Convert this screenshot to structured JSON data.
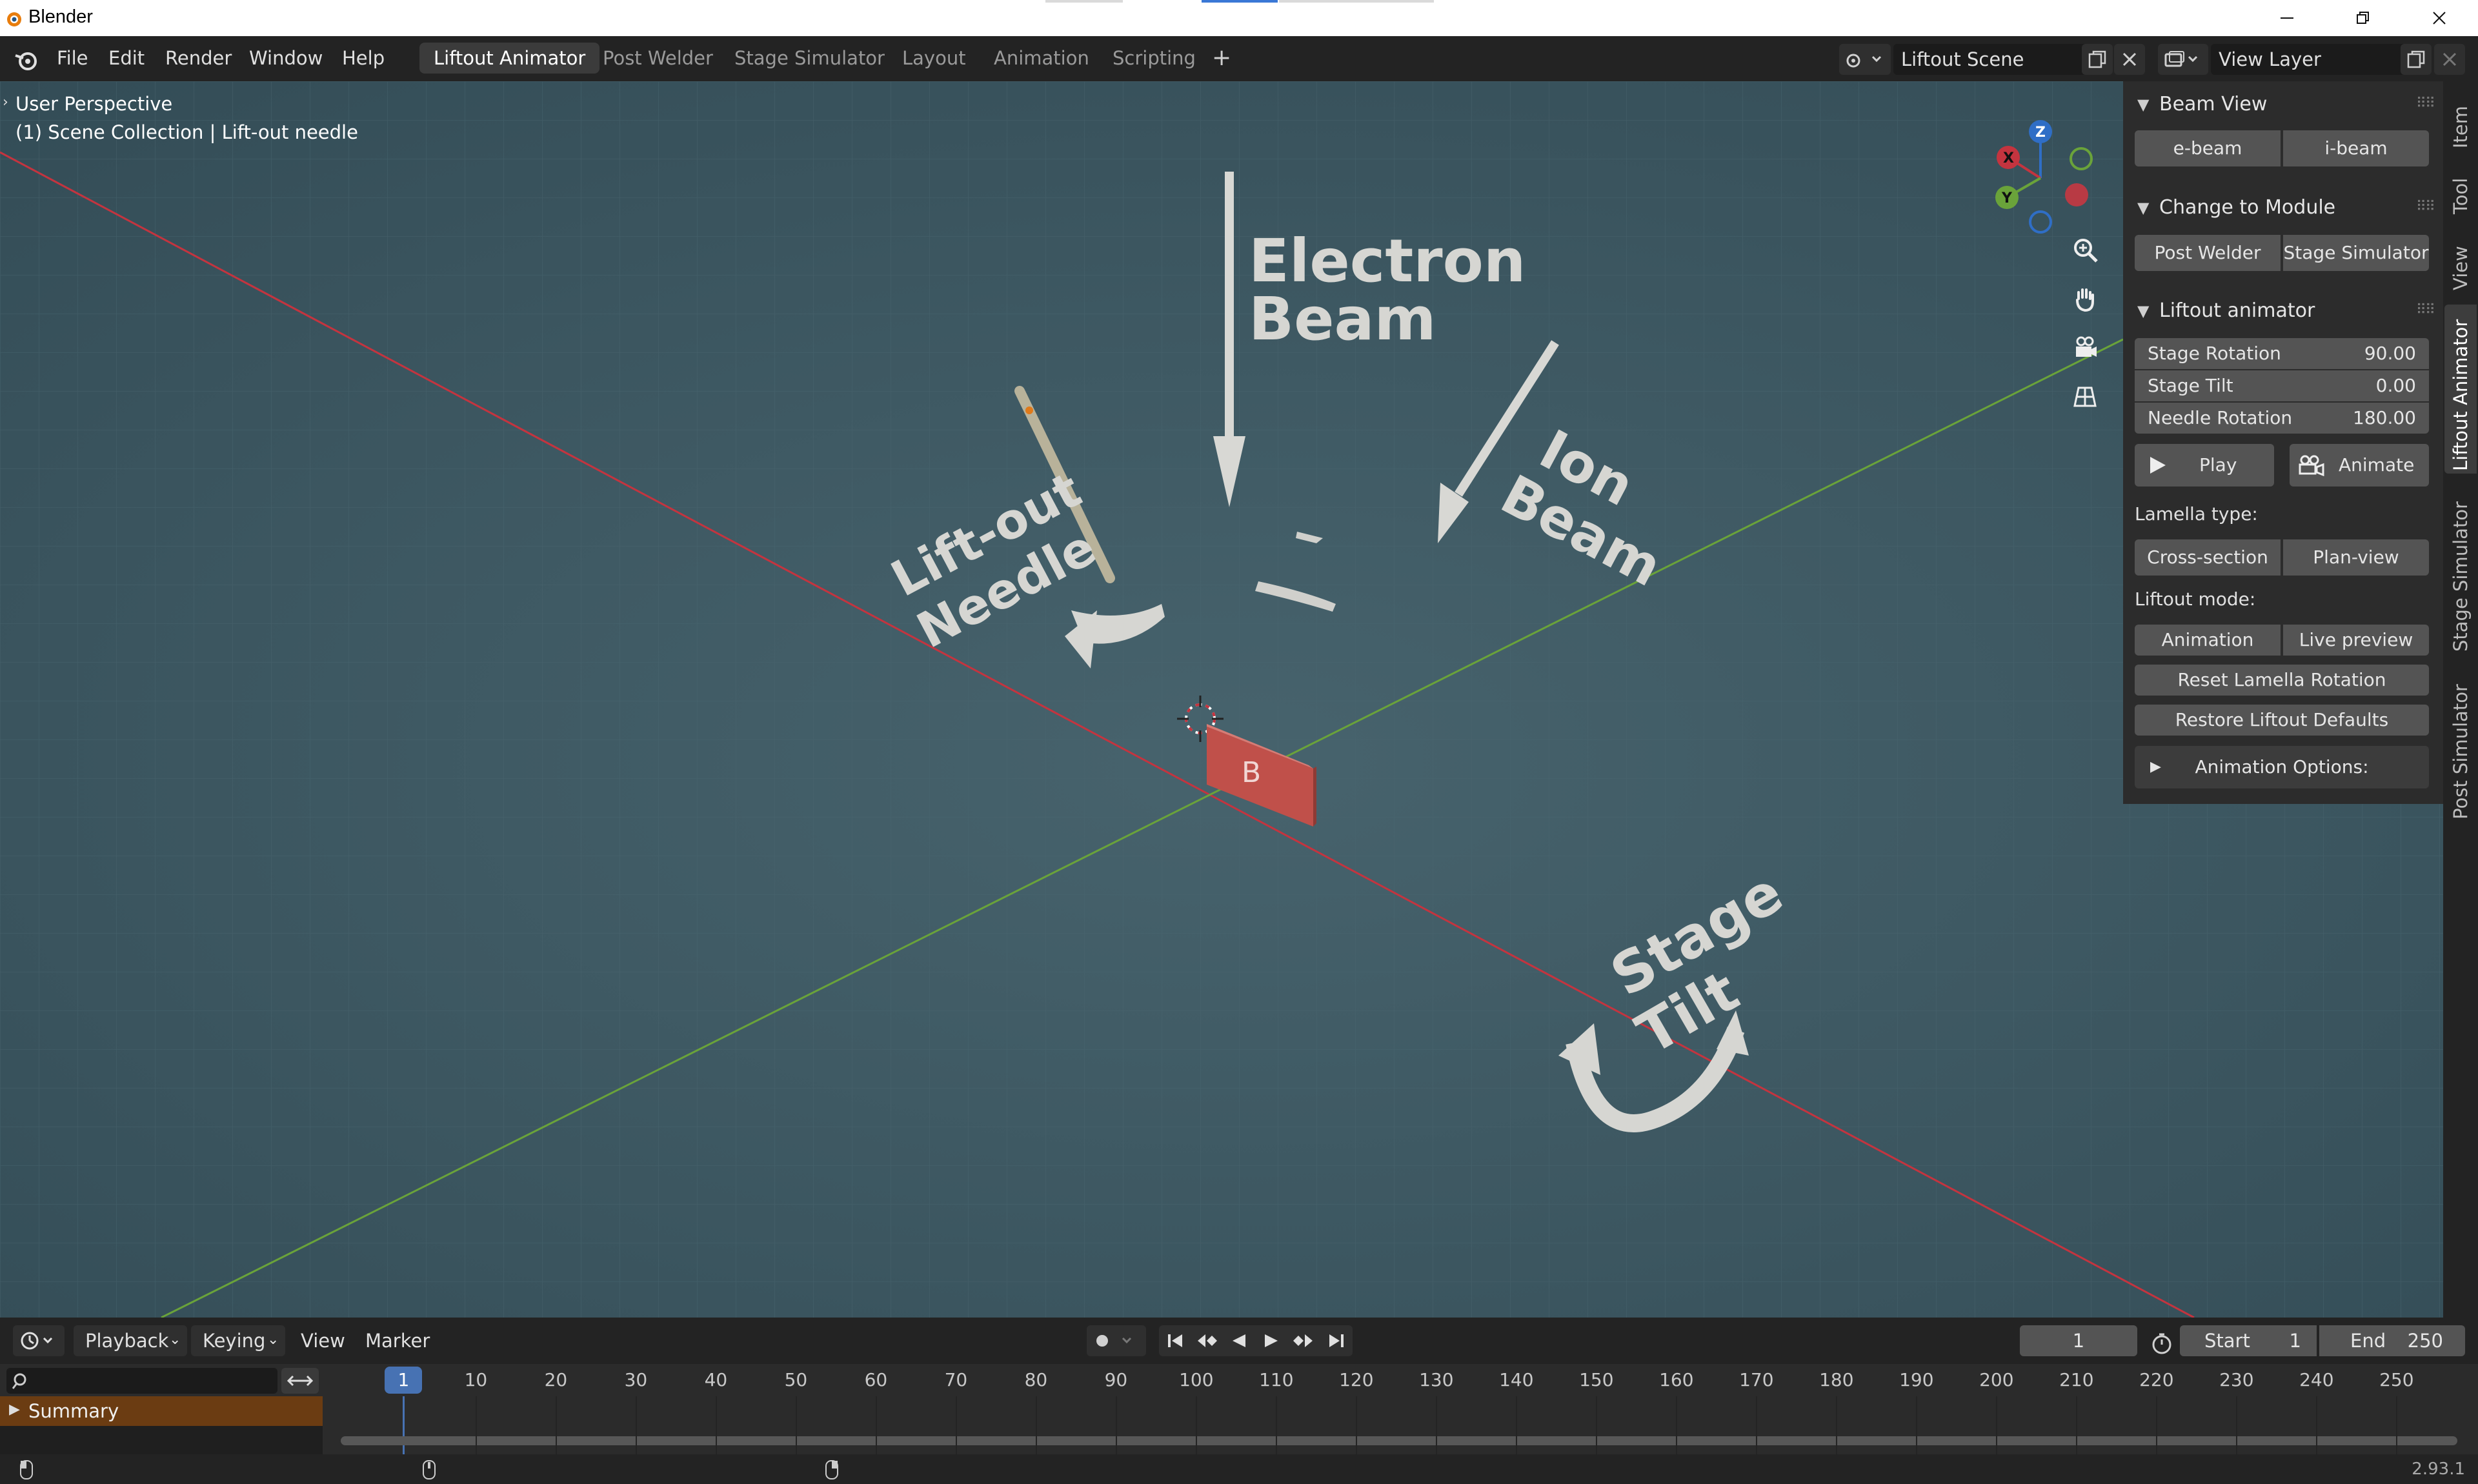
{
  "window": {
    "title": "Blender",
    "controls": [
      "minimize",
      "restore",
      "close"
    ]
  },
  "menu": [
    "File",
    "Edit",
    "Render",
    "Window",
    "Help"
  ],
  "workspaces": [
    {
      "label": "Liftout Animator",
      "active": true
    },
    {
      "label": "Post Welder",
      "active": false
    },
    {
      "label": "Stage Simulator",
      "active": false
    },
    {
      "label": "Layout",
      "active": false
    },
    {
      "label": "Animation",
      "active": false
    },
    {
      "label": "Scripting",
      "active": false
    }
  ],
  "add_workspace": "+",
  "scene": {
    "name": "Liftout Scene",
    "view_layer": "View Layer"
  },
  "viewport": {
    "perspective": "User Perspective",
    "collection": "(1) Scene Collection | Lift-out needle",
    "gizmo": {
      "x": "X",
      "y": "Y",
      "z": "Z"
    },
    "labels": {
      "electron_beam_1": "Electron",
      "electron_beam_2": "Beam",
      "ion_beam_1": "Ion",
      "ion_beam_2": "Beam",
      "needle_1": "Lift-out",
      "needle_2": "Needle",
      "stage_tilt_1": "Stage",
      "stage_tilt_2": "Tilt",
      "sample": "B"
    }
  },
  "npanel": {
    "tabs": [
      "Item",
      "Tool",
      "View",
      "Liftout Animator",
      "Stage Simulator",
      "Post Simulator"
    ],
    "active_tab": "Liftout Animator",
    "beam_view": {
      "title": "Beam View",
      "buttons": [
        "e-beam",
        "i-beam"
      ]
    },
    "change_module": {
      "title": "Change to Module",
      "buttons": [
        "Post Welder",
        "Stage Simulator"
      ]
    },
    "liftout": {
      "title": "Liftout animator",
      "fields": [
        {
          "label": "Stage Rotation",
          "value": "90.00"
        },
        {
          "label": "Stage Tilt",
          "value": "0.00"
        },
        {
          "label": "Needle Rotation",
          "value": "180.00"
        }
      ],
      "play": "Play",
      "animate": "Animate",
      "lamella_label": "Lamella type:",
      "lamella": [
        "Cross-section",
        "Plan-view"
      ],
      "mode_label": "Liftout mode:",
      "mode": [
        "Animation",
        "Live preview"
      ],
      "reset": "Reset Lamella Rotation",
      "restore": "Restore Liftout Defaults",
      "options": "Animation Options:"
    }
  },
  "timeline": {
    "menus": [
      "Playback",
      "Keying",
      "View",
      "Marker"
    ],
    "current_frame": "1",
    "start_label": "Start",
    "start": "1",
    "end_label": "End",
    "end": "250",
    "ticks": [
      "1",
      "10",
      "20",
      "30",
      "40",
      "50",
      "60",
      "70",
      "80",
      "90",
      "100",
      "110",
      "120",
      "130",
      "140",
      "150",
      "160",
      "170",
      "180",
      "190",
      "200",
      "210",
      "220",
      "230",
      "240",
      "250"
    ],
    "summary": "Summary"
  },
  "status": {
    "version": "2.93.1"
  },
  "colors": {
    "accent": "#4772b3",
    "x_axis": "#c4343f",
    "y_axis": "#6aa33a",
    "z_axis": "#2f6ec6",
    "sample": "#c0504a",
    "summary": "#6b3c12"
  }
}
